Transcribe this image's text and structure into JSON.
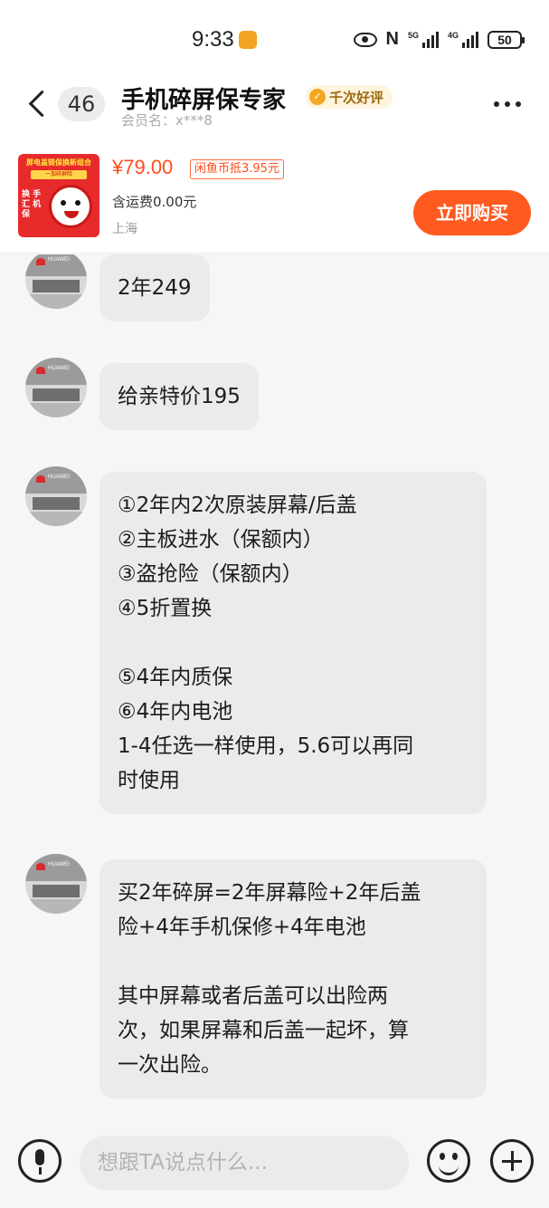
{
  "status_bar": {
    "time": "9:33",
    "battery": "50",
    "net1": "5G",
    "net2": "4G"
  },
  "header": {
    "back_icon": "chevron-left-icon",
    "unread_count": "46",
    "title": "手机碎屏保专家",
    "praise_tag": "千次好评",
    "member_name": "会员名：x***8",
    "more_icon": "more-dots-icon"
  },
  "product": {
    "thumb_top": "屏电盖链保换新组合",
    "thumb_band": "一加碎屏险",
    "thumb_side": "换 手 汇 机 保",
    "price": "¥79.00",
    "coin_discount": "闲鱼币抵3.95元",
    "shipping": "含运费0.00元",
    "location": "上海",
    "buy_label": "立即购买"
  },
  "messages": [
    {
      "text": "2年249"
    },
    {
      "text": "给亲特价195"
    },
    {
      "text": "①2年内2次原装屏幕/后盖\n②主板进水（保额内）\n③盗抢险（保额内）\n④5折置换\n\n⑤4年内质保\n⑥4年内电池\n1-4任选一样使用，5.6可以再同\n时使用"
    },
    {
      "text": "买2年碎屏=2年屏幕险+2年后盖\n险+4年手机保修+4年电池\n\n其中屏幕或者后盖可以出险两\n次，如果屏幕和后盖一起坏，算\n一次出险。"
    }
  ],
  "input_bar": {
    "placeholder": "想跟TA说点什么...",
    "voice_icon": "microphone-icon",
    "emoji_icon": "emoji-icon",
    "plus_icon": "plus-icon"
  },
  "colors": {
    "accent": "#ff5a1f",
    "price": "#ff4d1a",
    "bubble": "#ebebeb"
  }
}
